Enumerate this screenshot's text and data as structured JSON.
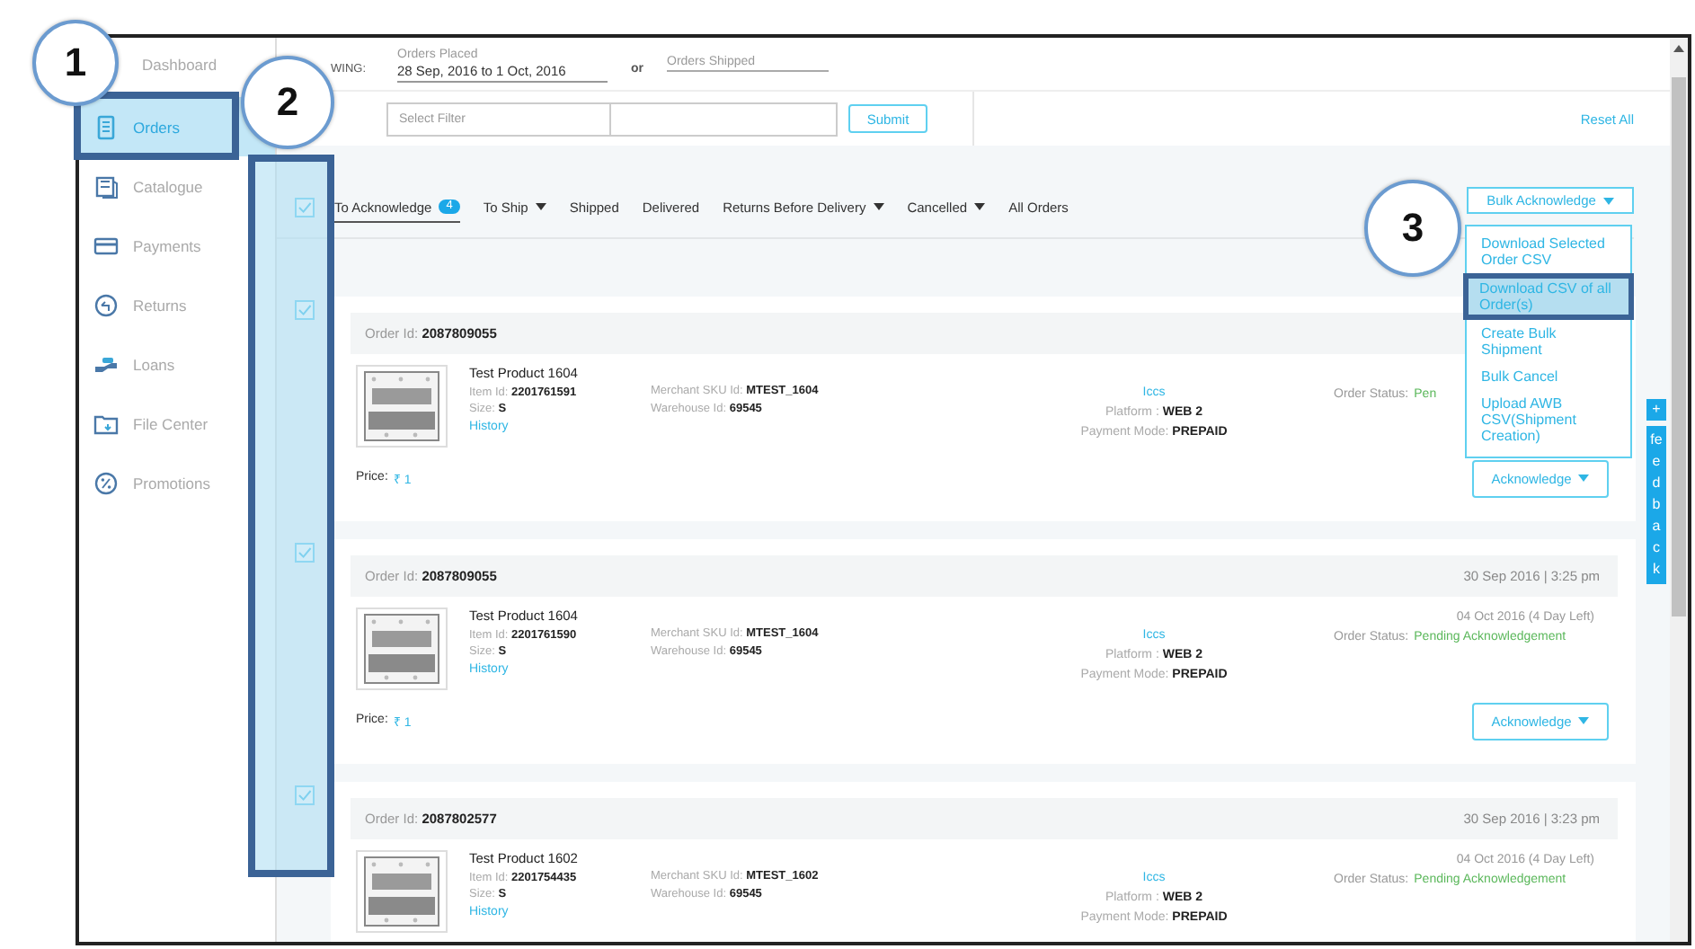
{
  "sidebar": {
    "items": [
      {
        "label": "Dashboard",
        "selected": false
      },
      {
        "label": "Orders",
        "selected": true
      },
      {
        "label": "Catalogue",
        "selected": false
      },
      {
        "label": "Payments",
        "selected": false
      },
      {
        "label": "Returns",
        "selected": false
      },
      {
        "label": "Loans",
        "selected": false
      },
      {
        "label": "File Center",
        "selected": false
      },
      {
        "label": "Promotions",
        "selected": false
      }
    ]
  },
  "filters": {
    "showing_label": "WING:",
    "placed_label": "Orders Placed",
    "placed_value": "28 Sep, 2016 to 1 Oct, 2016",
    "or": "or",
    "shipped_placeholder": "Orders Shipped",
    "filter_placeholder": "Select Filter",
    "submit": "Submit",
    "reset": "Reset All"
  },
  "tab_checkbox": {
    "checked": true
  },
  "tabs": [
    {
      "label": "To Acknowledge",
      "selected": true,
      "count": "4",
      "has_menu": false
    },
    {
      "label": "To Ship",
      "selected": false,
      "has_menu": true
    },
    {
      "label": "Shipped",
      "selected": false,
      "has_menu": false
    },
    {
      "label": "Delivered",
      "selected": false,
      "has_menu": false
    },
    {
      "label": "Returns Before Delivery",
      "selected": false,
      "has_menu": true
    },
    {
      "label": "Cancelled",
      "selected": false,
      "has_menu": true
    },
    {
      "label": "All Orders",
      "selected": false,
      "has_menu": false
    }
  ],
  "bulk_action": {
    "label": "Bulk Acknowledge",
    "menu": [
      {
        "label": "Download Selected Order CSV",
        "selected": false
      },
      {
        "label": "Download CSV of all Order(s)",
        "selected": true
      },
      {
        "label": "Create Bulk Shipment",
        "selected": false
      },
      {
        "label": "Bulk Cancel",
        "selected": false
      },
      {
        "label": "Upload AWB CSV(Shipment Creation)",
        "selected": false
      }
    ]
  },
  "orders": [
    {
      "checked": true,
      "order_id": "Order Id: **2087809055**",
      "product": "Test Product  1604",
      "item_id": "Item Id: **2201761591**",
      "size": "Size: **S**",
      "history": "History",
      "sku": "Merchant SKU Id: **MTEST_1604**",
      "warehouse": "Warehouse Id: **69545**",
      "courier": "Iccs",
      "platform": "Platform : **WEB 2**",
      "payment": "Payment Mode: **PREPAID**",
      "status_label": "Order Status:",
      "status": "Pen",
      "price_label": "Price:",
      "price": "₹ 1",
      "action": "Acknowledge"
    },
    {
      "checked": true,
      "order_id": "Order Id: **2087809055**",
      "placed": "30 Sep 2016 | 3:25 pm",
      "product": "Test Product  1604",
      "item_id": "Item Id: **2201761590**",
      "size": "Size: **S**",
      "history": "History",
      "sku": "Merchant SKU Id: **MTEST_1604**",
      "warehouse": "Warehouse Id: **69545**",
      "courier": "Iccs",
      "platform": "Platform : **WEB 2**",
      "payment": "Payment Mode: **PREPAID**",
      "due": "04 Oct 2016 (4 Day Left)",
      "status_label": "Order Status:",
      "status": "Pending Acknowledgement",
      "price_label": "Price:",
      "price": "₹ 1",
      "action": "Acknowledge"
    },
    {
      "checked": true,
      "order_id": "Order Id: **2087802577**",
      "placed": "30 Sep 2016 | 3:23 pm",
      "product": "Test Product  1602",
      "item_id": "Item Id: **2201754435**",
      "size": "Size: **S**",
      "history": "History",
      "sku": "Merchant SKU Id: **MTEST_1602**",
      "warehouse": "Warehouse Id: **69545**",
      "courier": "Iccs",
      "platform": "Platform : **WEB 2**",
      "payment": "Payment Mode: **PREPAID**",
      "due": "04 Oct 2016 (4 Day Left)",
      "status_label": "Order Status:",
      "status": "Pending Acknowledgement"
    }
  ],
  "feedback": {
    "plus": "+",
    "label": "feedback"
  },
  "callouts": [
    "1",
    "2",
    "3"
  ]
}
